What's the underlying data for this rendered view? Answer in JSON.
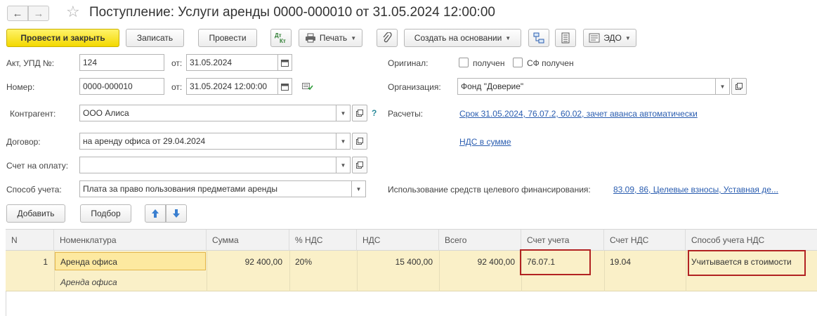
{
  "title": "Поступление: Услуги аренды 0000-000010 от 31.05.2024 12:00:00",
  "toolbar": {
    "post_close": "Провести и закрыть",
    "save": "Записать",
    "post": "Провести",
    "print": "Печать",
    "create_based_on": "Создать на основании",
    "edo": "ЭДО"
  },
  "form": {
    "act_label": "Акт, УПД №:",
    "act_value": "124",
    "from_label": "от:",
    "act_date": "31.05.2024",
    "number_label": "Номер:",
    "number_value": "0000-000010",
    "number_date": "31.05.2024 12:00:00",
    "original_label": "Оригинал:",
    "received_label": "получен",
    "sf_received_label": "СФ получен",
    "org_label": "Организация:",
    "org_value": "Фонд \"Доверие\"",
    "counterparty_label": "Контрагент:",
    "counterparty_value": "ООО Алиса",
    "help_mark": "?",
    "settlements_label": "Расчеты:",
    "settlements_link": "Срок 31.05.2024, 76.07.2, 60.02, зачет аванса автоматически",
    "contract_label": "Договор:",
    "contract_value": "на аренду офиса от 29.04.2024",
    "vat_link": "НДС в сумме",
    "invoice_label": "Счет на оплату:",
    "invoice_value": "",
    "accounting_label": "Способ учета:",
    "accounting_value": "Плата за право пользования предметами аренды",
    "target_funding_label": "Использование средств целевого финансирования:",
    "target_funding_link": "83.09, 86, Целевые взносы, Уставная де..."
  },
  "table_toolbar": {
    "add": "Добавить",
    "pick": "Подбор"
  },
  "table": {
    "headers": [
      "N",
      "Номенклатура",
      "Сумма",
      "% НДС",
      "НДС",
      "Всего",
      "Счет учета",
      "Счет НДС",
      "Способ учета НДС"
    ],
    "rows": [
      {
        "n": "1",
        "item": "Аренда офиса",
        "item_sub": "Аренда офиса",
        "sum": "92 400,00",
        "vat_rate": "20%",
        "vat": "15 400,00",
        "total": "92 400,00",
        "account": "76.07.1",
        "vat_account": "19.04",
        "vat_method": "Учитывается в стоимости"
      }
    ]
  },
  "colors": {
    "primary_button": "#f3d800",
    "link": "#2a5db0",
    "row_highlight": "#faf0c8",
    "annotation_box": "#b22222"
  },
  "icons": [
    "back-arrow-icon",
    "forward-arrow-icon",
    "favorite-star-icon",
    "dt-kt-icon",
    "printer-icon",
    "paperclip-icon",
    "structure-icon",
    "document-list-icon",
    "edo-icon",
    "calendar-icon",
    "dropdown-icon",
    "open-form-icon",
    "document-ok-icon",
    "move-up-icon",
    "move-down-icon"
  ]
}
